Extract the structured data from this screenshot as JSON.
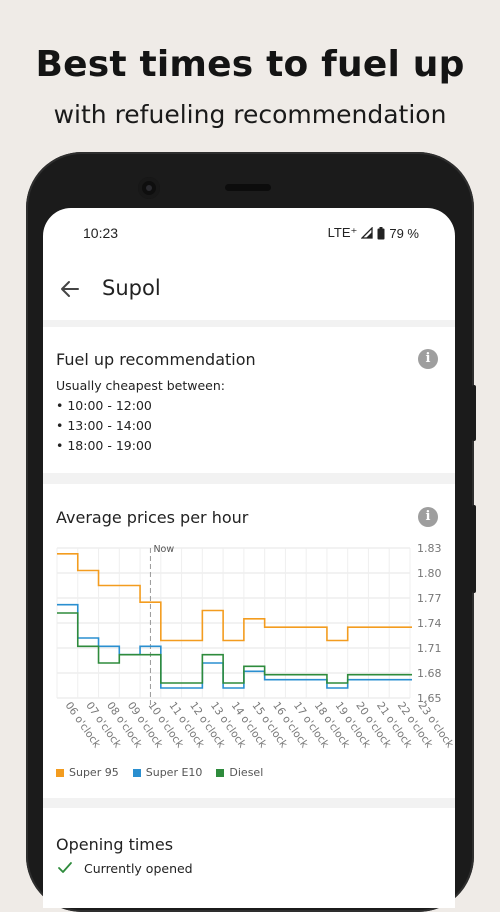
{
  "promo": {
    "title": "Best times to fuel up",
    "subtitle": "with refueling recommendation"
  },
  "status_bar": {
    "time": "10:23",
    "network": "LTE⁺",
    "battery": "79 %"
  },
  "app_bar": {
    "title": "Supol",
    "back_icon": "arrow-back-icon"
  },
  "recommendation": {
    "title": "Fuel up recommendation",
    "intro": "Usually cheapest between:",
    "ranges": [
      "• 10:00 - 12:00",
      "• 13:00 - 14:00",
      "• 18:00 - 19:00"
    ],
    "info_icon": "info-icon"
  },
  "prices": {
    "title": "Average prices per hour",
    "info_icon": "info-icon"
  },
  "opening": {
    "title": "Opening times",
    "status": "Currently opened",
    "status_icon": "check-icon"
  },
  "colors": {
    "super95": "#f39c1f",
    "super_e10": "#2a8fd0",
    "diesel": "#2e8b3c",
    "background": "#efebe7"
  },
  "chart_data": {
    "type": "line",
    "step": true,
    "categories": [
      "06 o'clock",
      "07 o'clock",
      "08 o'clock",
      "09 o'clock",
      "10 o'clock",
      "11 o'clock",
      "12 o'clock",
      "13 o'clock",
      "14 o'clock",
      "15 o'clock",
      "16 o'clock",
      "17 o'clock",
      "18 o'clock",
      "19 o'clock",
      "20 o'clock",
      "21 o'clock",
      "22 o'clock",
      "23 o'clock"
    ],
    "tick_labels": [
      "06 o'clock",
      "07 o'clock",
      "08 o'clock",
      "09 o'clock",
      "10 o'clock",
      "11 o'clock",
      "12 o'clock",
      "13 o'clock",
      "14 o'clock",
      "15 o'clock",
      "16 o'clock",
      "17 o'clock",
      "18 o'clock",
      "19 o'clock",
      "20 o'clock",
      "21 o'clock",
      "22 o'clock",
      "23 o'clock"
    ],
    "y_ticks": [
      "1.83",
      "1.80",
      "1.77",
      "1.74",
      "1.71",
      "1.68",
      "1.65"
    ],
    "ylim": [
      1.65,
      1.83
    ],
    "now_label": "Now",
    "now_index": 4.5,
    "series": [
      {
        "name": "Super 95",
        "color": "#f39c1f",
        "values": [
          1.823,
          1.803,
          1.785,
          1.785,
          1.765,
          1.719,
          1.719,
          1.755,
          1.719,
          1.745,
          1.735,
          1.735,
          1.735,
          1.719,
          1.735,
          1.735,
          1.735,
          1.735
        ]
      },
      {
        "name": "Super E10",
        "color": "#2a8fd0",
        "values": [
          1.762,
          1.722,
          1.712,
          1.702,
          1.712,
          1.662,
          1.662,
          1.692,
          1.662,
          1.682,
          1.672,
          1.672,
          1.672,
          1.662,
          1.672,
          1.672,
          1.672,
          1.672
        ]
      },
      {
        "name": "Diesel",
        "color": "#2e8b3c",
        "values": [
          1.752,
          1.712,
          1.692,
          1.702,
          1.702,
          1.668,
          1.668,
          1.702,
          1.668,
          1.688,
          1.678,
          1.678,
          1.678,
          1.668,
          1.678,
          1.678,
          1.678,
          1.678
        ]
      }
    ]
  }
}
